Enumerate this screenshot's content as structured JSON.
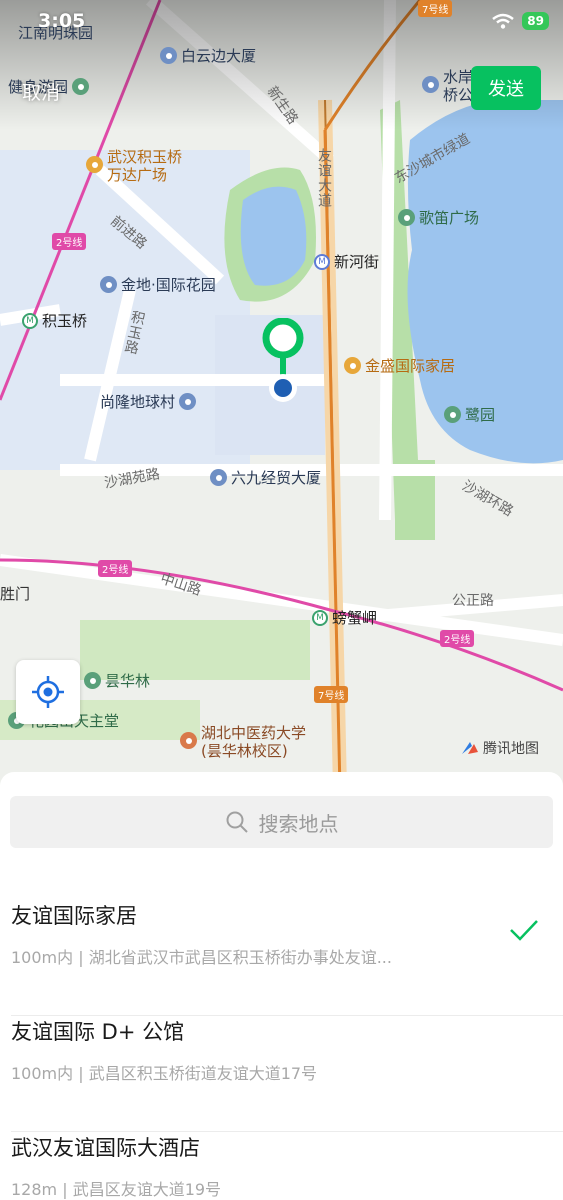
{
  "status_bar": {
    "time": "3:05",
    "battery": "89"
  },
  "top_bar": {
    "cancel_label": "取消",
    "send_label": "发送"
  },
  "map": {
    "pois": [
      {
        "label": "江南明珠园",
        "color": "blue"
      },
      {
        "label": "白云边大厦",
        "color": "blue"
      },
      {
        "label": "健身游园",
        "color": "green"
      },
      {
        "label": "水岸",
        "color": "blue"
      },
      {
        "label": "桥公",
        "color": "blue"
      },
      {
        "label": "武汉积玉桥",
        "color": "orange"
      },
      {
        "label": "万达广场",
        "color": "orange"
      },
      {
        "label": "歌笛广场",
        "color": "green"
      },
      {
        "label": "金地·国际花园",
        "color": "blue"
      },
      {
        "label": "金盛国际家居",
        "color": "orange"
      },
      {
        "label": "尚隆地球村",
        "color": "blue"
      },
      {
        "label": "鹭园",
        "color": "green"
      },
      {
        "label": "六九经贸大厦",
        "color": "blue"
      },
      {
        "label": "昙华林",
        "color": "green"
      },
      {
        "label": "花园山天主堂",
        "color": "green"
      },
      {
        "label": "湖北中医药大学",
        "color": "brown"
      },
      {
        "label": "(昙华林校区)",
        "color": "brown"
      }
    ],
    "metro_stations": [
      "新河街",
      "积玉桥",
      "螃蟹岬"
    ],
    "roads": [
      "新生路",
      "友谊大道",
      "东沙城市绿道",
      "前进路",
      "积玉路",
      "沙湖苑路",
      "沙湖环路",
      "中山路",
      "公正路",
      "胜门"
    ],
    "line_badges": [
      "7号线",
      "2号线",
      "2号线",
      "2号线",
      "7号线"
    ],
    "attribution": "腾讯地图"
  },
  "search": {
    "placeholder": "搜索地点"
  },
  "results": [
    {
      "name": "友谊国际家居",
      "address": "100m内 | 湖北省武汉市武昌区积玉桥街办事处友谊...",
      "selected": true
    },
    {
      "name": "友谊国际 D+ 公馆",
      "address": "100m内 | 武昌区积玉桥街道友谊大道17号",
      "selected": false
    },
    {
      "name": "武汉友谊国际大酒店",
      "address": "128m | 武昌区友谊大道19号",
      "selected": false
    }
  ],
  "colors": {
    "accent": "#07c160",
    "line2": "#e04aa8",
    "line7": "#e0822a",
    "water": "#9cc4ee"
  }
}
